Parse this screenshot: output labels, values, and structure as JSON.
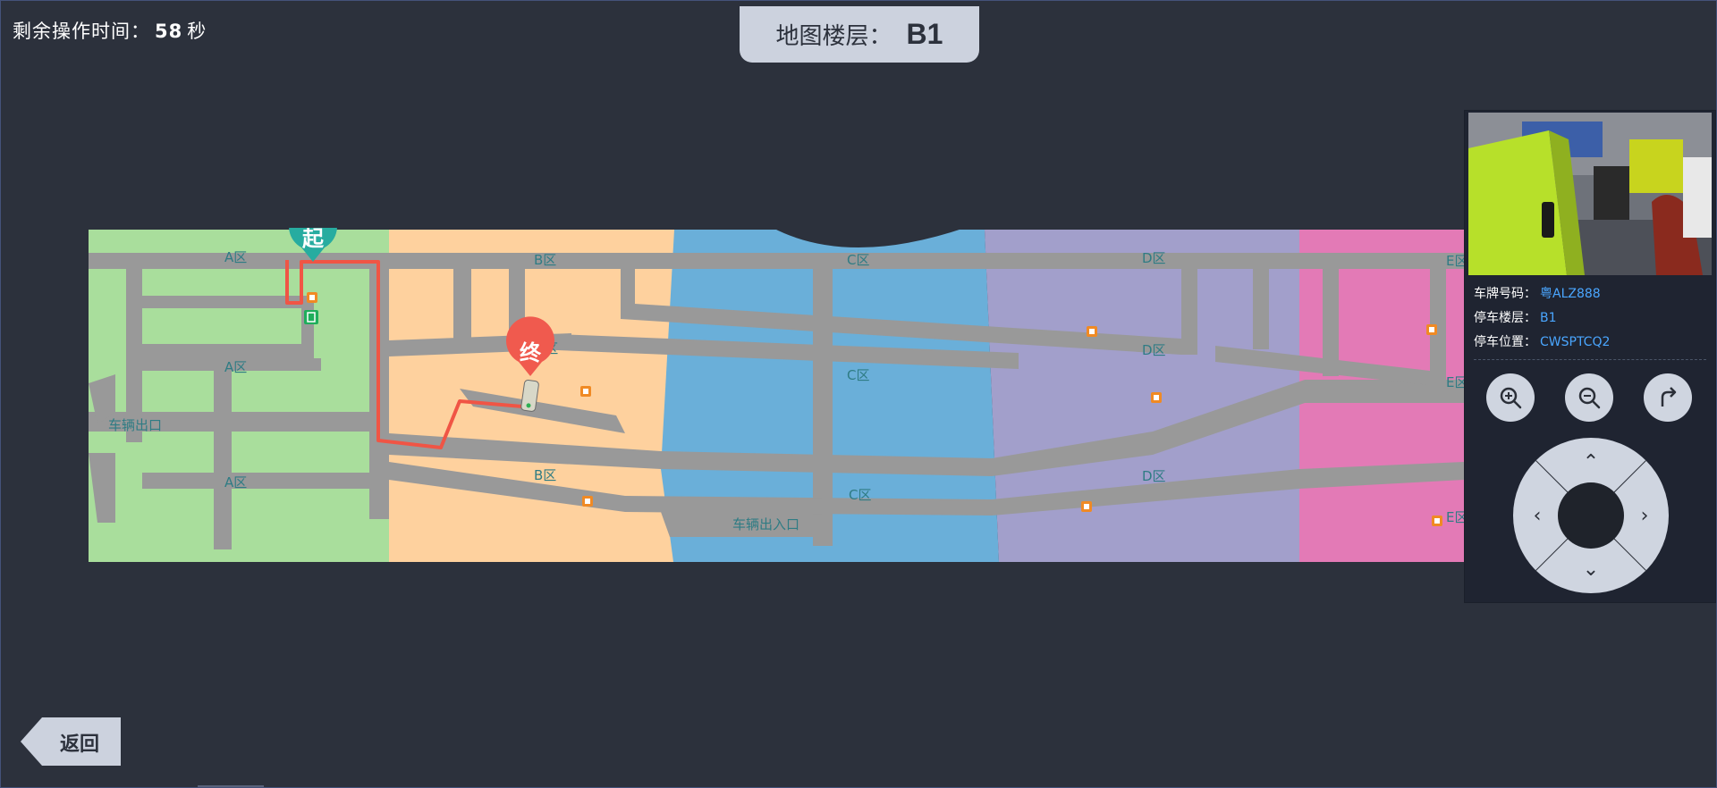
{
  "countdown": {
    "prefix": "剩余操作时间：",
    "seconds": "58",
    "unit": "秒"
  },
  "floor": {
    "label": "地图楼层：",
    "value": "B1"
  },
  "map": {
    "zones": [
      "A区",
      "A区",
      "A区",
      "B区",
      "B区",
      "B区",
      "C区",
      "C区",
      "C区",
      "D区",
      "D区",
      "D区",
      "E区",
      "E区",
      "E区"
    ],
    "exit_label": "车辆出口",
    "entrance_exit_label": "车辆出入口",
    "start_marker": "起",
    "end_marker": "终",
    "colors": {
      "zone_a": "#a9de9c",
      "zone_b": "#fed19e",
      "zone_c": "#6aafd9",
      "zone_d": "#a29fcb",
      "zone_e": "#e37ab6",
      "road": "#999999",
      "route": "#f05545",
      "start": "#27aca0",
      "end": "#f05a4e"
    }
  },
  "vehicle": {
    "plate_label": "车牌号码：",
    "plate": "粤ALZ888",
    "floor_label": "停车楼层：",
    "floor": "B1",
    "position_label": "停车位置：",
    "position": "CWSPTCQ2"
  },
  "controls": {
    "zoom_in": "zoom-in-icon",
    "zoom_out": "zoom-out-icon",
    "rotate": "rotate-icon",
    "up": "⌃",
    "down": "⌄",
    "left": "‹",
    "right": "›"
  },
  "back_label": "返回"
}
